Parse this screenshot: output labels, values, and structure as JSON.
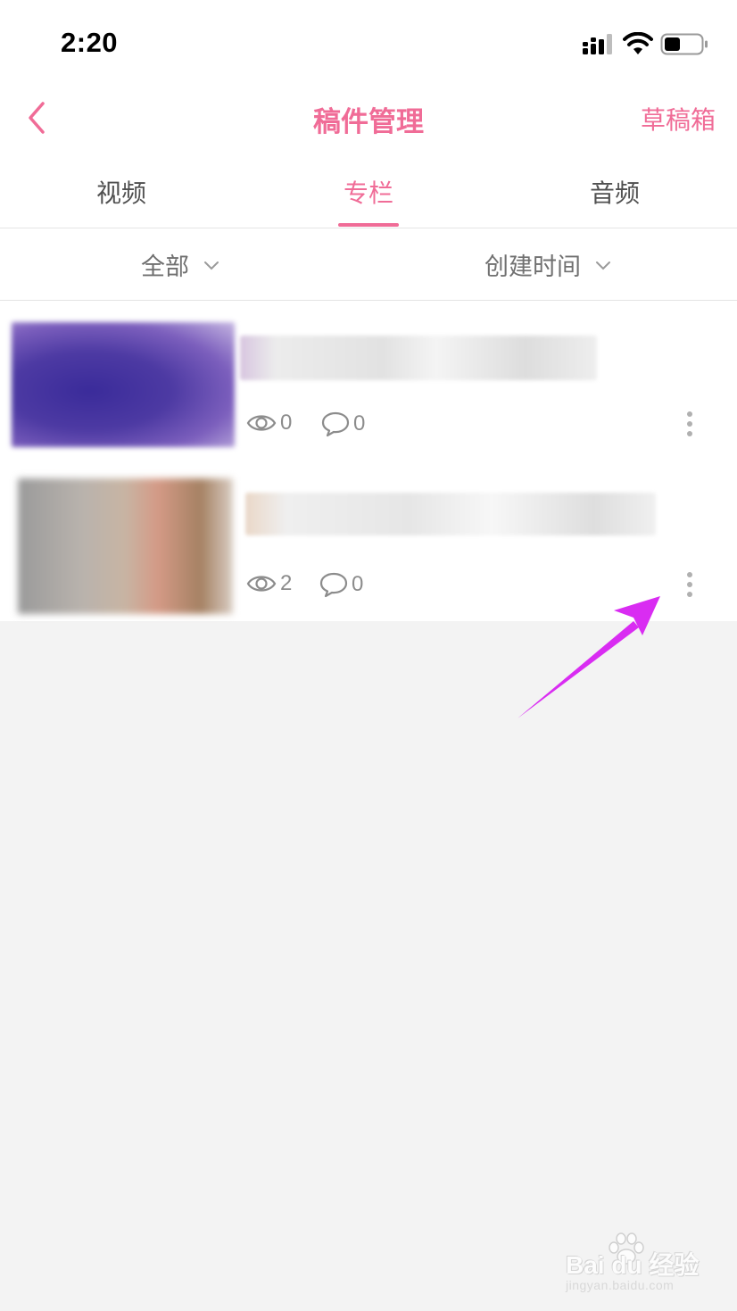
{
  "status_bar": {
    "time": "2:20"
  },
  "header": {
    "title": "稿件管理",
    "drafts_label": "草稿箱"
  },
  "tabs": [
    {
      "label": "视频",
      "active": false
    },
    {
      "label": "专栏",
      "active": true
    },
    {
      "label": "音频",
      "active": false
    }
  ],
  "filters": {
    "category": "全部",
    "sort": "创建时间"
  },
  "items": [
    {
      "views": "0",
      "comments": "0"
    },
    {
      "views": "2",
      "comments": "0"
    }
  ],
  "colors": {
    "accent": "#f06c97",
    "arrow": "#d92cf2",
    "background": "#f3f3f3"
  },
  "watermark": {
    "main": "Bai du 经验",
    "sub": "jingyan.baidu.com"
  }
}
